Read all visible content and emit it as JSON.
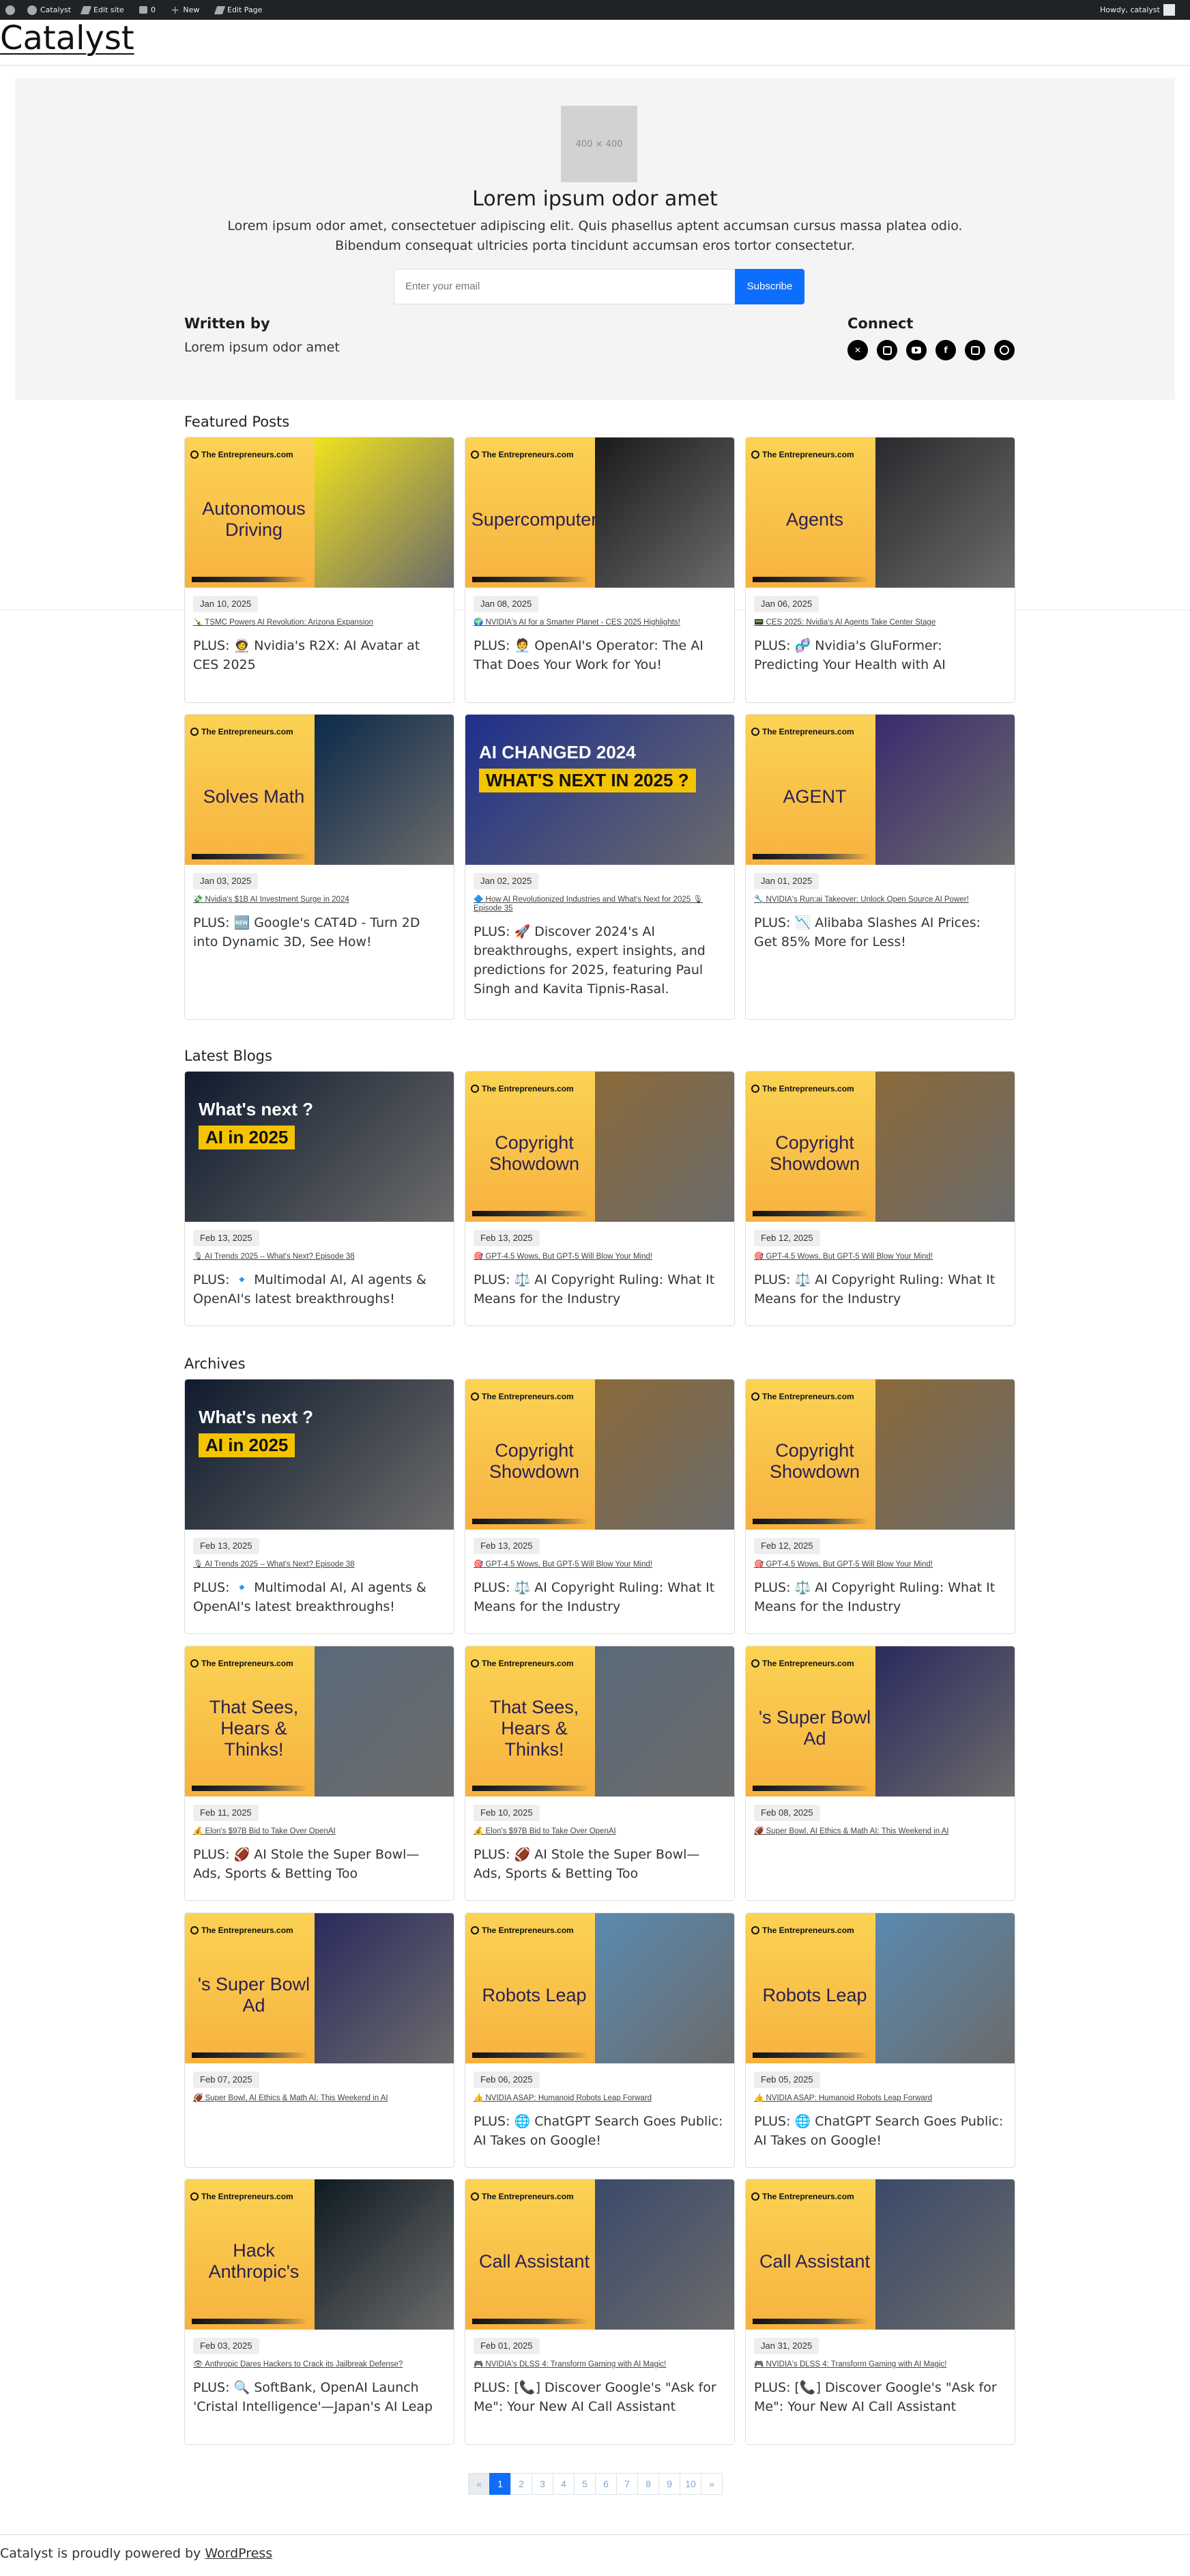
{
  "admin_bar": {
    "site": "Catalyst",
    "edit_site": "Edit site",
    "comments": "0",
    "new": "New",
    "edit_page": "Edit Page",
    "howdy": "Howdy, catalyst"
  },
  "site": {
    "title": "Catalyst"
  },
  "hero": {
    "image_placeholder": "400 × 400",
    "title": "Lorem ipsum odor amet",
    "description": "Lorem ipsum odor amet, consectetuer adipiscing elit. Quis phasellus aptent accumsan cursus massa platea odio. Bibendum consequat ultricies porta tincidunt accumsan eros tortor consectetur.",
    "email_placeholder": "Enter your email",
    "subscribe_label": "Subscribe",
    "written_by_label": "Written by",
    "written_by_value": "Lorem ipsum odor amet",
    "connect_label": "Connect",
    "socials": [
      "x-icon",
      "linkedin-icon",
      "youtube-icon",
      "facebook-icon",
      "instagram-icon",
      "threads-icon"
    ]
  },
  "sections": {
    "featured": "Featured Posts",
    "latest": "Latest Blogs",
    "archives": "Archives"
  },
  "featured_posts": [
    {
      "date": "Jan 10, 2025",
      "source": "🍾 TSMC Powers AI Revolution: Arizona Expansion",
      "title": "PLUS: 🧑‍🚀 Nvidia's R2X: AI Avatar at CES 2025",
      "thumb_headline": "Autonomous Driving",
      "accent": "#f0e21e"
    },
    {
      "date": "Jan 08, 2025",
      "source": "🌍 NVIDIA's AI for a Smarter Planet - CES 2025 Highlights!",
      "title": "PLUS: 🧑‍💼 OpenAI's Operator: The AI That Does Your Work for You!",
      "thumb_headline": "Supercomputer",
      "accent": "#1a1a1a"
    },
    {
      "date": "Jan 06, 2025",
      "source": "📟 CES 2025: Nvidia's AI Agents Take Center Stage",
      "title": "PLUS: 🧬 Nvidia's GluFormer: Predicting Your Health with AI",
      "thumb_headline": "Agents",
      "accent": "#2a2a2e"
    },
    {
      "date": "Jan 03, 2025",
      "source": "💸 Nvidia's $1B AI Investment Surge in 2024",
      "title": "PLUS: 🆕 Google's CAT4D - Turn 2D into Dynamic 3D, See How!",
      "thumb_headline": "Solves Math",
      "accent": "#0b2a4a"
    },
    {
      "date": "Jan 02, 2025",
      "source": "🔷 How AI Revolutionized Industries and What's Next for 2025 🎙 Episode 35",
      "title": "PLUS: 🚀 Discover 2024's AI breakthroughs, expert insights, and predictions for 2025, featuring Paul Singh and Kavita Tipnis-Rasal.",
      "thumb_headline": "AI CHANGED 2024",
      "thumb_sub": "WHAT'S NEXT IN 2025 ?",
      "accent": "#1f2f8c"
    },
    {
      "date": "Jan 01, 2025",
      "source": "🔧 NVIDIA's Run:ai Takeover: Unlock Open Source AI Power!",
      "title": "PLUS: 📉 Alibaba Slashes AI Prices: Get 85% More for Less!",
      "thumb_headline": "AGENT",
      "accent": "#3b2a6e"
    }
  ],
  "latest_blogs": [
    {
      "date": "Feb 13, 2025",
      "source": "🎙 AI Trends 2025 – What's Next? Episode 38",
      "title": "PLUS: 🔹 Multimodal AI, AI agents & OpenAI's latest breakthroughs!",
      "thumb_headline": "What's next ?",
      "thumb_sub": "AI in 2025",
      "accent": "#0f1b2d"
    },
    {
      "date": "Feb 13, 2025",
      "source": "🎯 GPT-4.5 Wows, But GPT-5 Will Blow Your Mind!",
      "title": "PLUS: ⚖️ AI Copyright Ruling: What It Means for the Industry",
      "thumb_headline": "Copyright Showdown",
      "accent": "#8a6a3a"
    },
    {
      "date": "Feb 12, 2025",
      "source": "🎯 GPT-4.5 Wows, But GPT-5 Will Blow Your Mind!",
      "title": "PLUS: ⚖️ AI Copyright Ruling: What It Means for the Industry",
      "thumb_headline": "Copyright Showdown",
      "accent": "#8a6a3a"
    }
  ],
  "archives": [
    {
      "date": "Feb 13, 2025",
      "source": "🎙 AI Trends 2025 – What's Next? Episode 38",
      "title": "PLUS: 🔹 Multimodal AI, AI agents & OpenAI's latest breakthroughs!",
      "thumb_headline": "What's next ?",
      "thumb_sub": "AI in 2025",
      "accent": "#0f1b2d"
    },
    {
      "date": "Feb 13, 2025",
      "source": "🎯 GPT-4.5 Wows, But GPT-5 Will Blow Your Mind!",
      "title": "PLUS: ⚖️ AI Copyright Ruling: What It Means for the Industry",
      "thumb_headline": "Copyright Showdown",
      "accent": "#8a6a3a"
    },
    {
      "date": "Feb 12, 2025",
      "source": "🎯 GPT-4.5 Wows, But GPT-5 Will Blow Your Mind!",
      "title": "PLUS: ⚖️ AI Copyright Ruling: What It Means for the Industry",
      "thumb_headline": "Copyright Showdown",
      "accent": "#8a6a3a"
    },
    {
      "date": "Feb 11, 2025",
      "source": "💰 Elon's $97B Bid to Take Over OpenAI",
      "title": "PLUS: 🏈 AI Stole the Super Bowl—Ads, Sports & Betting Too",
      "thumb_headline": "That Sees, Hears & Thinks!",
      "accent": "#5a6a7a"
    },
    {
      "date": "Feb 10, 2025",
      "source": "💰 Elon's $97B Bid to Take Over OpenAI",
      "title": "PLUS: 🏈 AI Stole the Super Bowl—Ads, Sports & Betting Too",
      "thumb_headline": "That Sees, Hears & Thinks!",
      "accent": "#5a6a7a"
    },
    {
      "date": "Feb 08, 2025",
      "source": "🏈 Super Bowl, AI Ethics & Math AI: This Weekend in AI",
      "title": "",
      "thumb_headline": "'s Super Bowl Ad",
      "accent": "#2a2a5e"
    },
    {
      "date": "Feb 07, 2025",
      "source": "🏈 Super Bowl, AI Ethics & Math AI: This Weekend in AI",
      "title": "",
      "thumb_headline": "'s Super Bowl Ad",
      "accent": "#2a2a5e"
    },
    {
      "date": "Feb 06, 2025",
      "source": "👍 NVIDIA ASAP: Humanoid Robots Leap Forward",
      "title": "PLUS: 🌐 ChatGPT Search Goes Public: AI Takes on Google!",
      "thumb_headline": "Robots Leap",
      "accent": "#5a8ab0"
    },
    {
      "date": "Feb 05, 2025",
      "source": "👍 NVIDIA ASAP: Humanoid Robots Leap Forward",
      "title": "PLUS: 🌐 ChatGPT Search Goes Public: AI Takes on Google!",
      "thumb_headline": "Robots Leap",
      "accent": "#5a8ab0"
    },
    {
      "date": "Feb 03, 2025",
      "source": "👁 Anthropic Dares Hackers to Crack its Jailbreak Defense?",
      "title": "PLUS: 🔍 SoftBank, OpenAI Launch 'Cristal Intelligence'—Japan's AI Leap",
      "thumb_headline": "Hack Anthropic's",
      "accent": "#0e1a22"
    },
    {
      "date": "Feb 01, 2025",
      "source": "🎮 NVIDIA's DLSS 4: Transform Gaming with AI Magic!",
      "title": "PLUS: [📞] Discover Google's \"Ask for Me\": Your New AI Call Assistant",
      "thumb_headline": "Call Assistant",
      "accent": "#3a4a6a"
    },
    {
      "date": "Jan 31, 2025",
      "source": "🎮 NVIDIA's DLSS 4: Transform Gaming with AI Magic!",
      "title": "PLUS: [📞] Discover Google's \"Ask for Me\": Your New AI Call Assistant",
      "thumb_headline": "Call Assistant",
      "accent": "#3a4a6a"
    }
  ],
  "thumb_brand": "The Entrepreneurs.com",
  "pagination": {
    "prev": "«",
    "pages": [
      "1",
      "2",
      "3",
      "4",
      "5",
      "6",
      "7",
      "8",
      "9",
      "10"
    ],
    "next": "»",
    "current": "1"
  },
  "footer": {
    "text": "Catalyst is proudly powered by ",
    "link": "WordPress"
  }
}
